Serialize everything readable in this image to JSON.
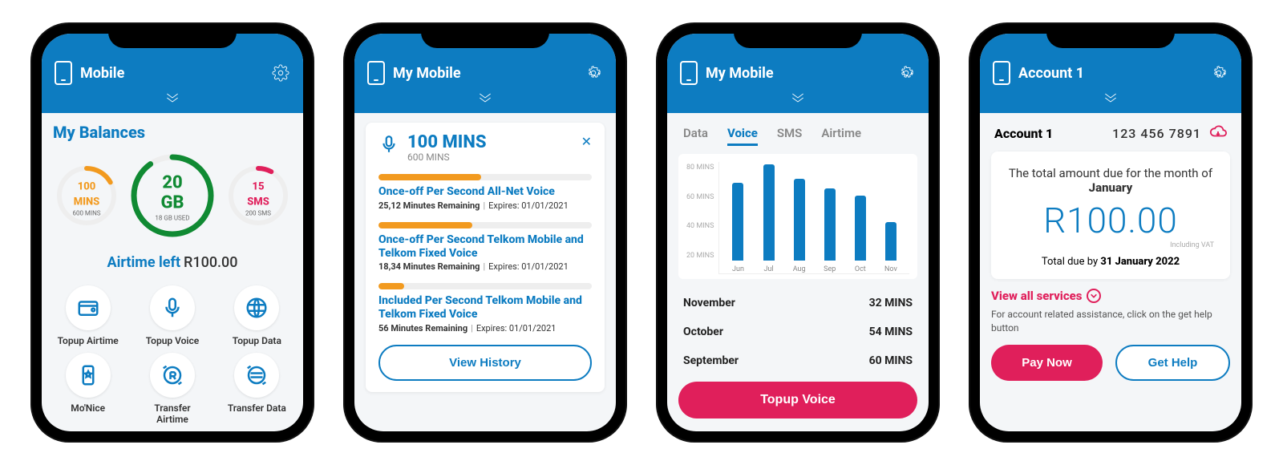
{
  "colors": {
    "brand": "#0d7cc1",
    "accent_pink": "#e01f5b",
    "accent_orange": "#f29a1f",
    "accent_green": "#108a33"
  },
  "phone1": {
    "header_title": "Mobile",
    "balances_title": "My Balances",
    "gauges": {
      "mins": {
        "value": "100 MINS",
        "sub": "600 MINS",
        "pct": 17
      },
      "data": {
        "value": "20 GB",
        "sub": "18 GB USED",
        "pct": 90
      },
      "sms": {
        "value": "15 SMS",
        "sub": "200 SMS",
        "pct": 8
      }
    },
    "airtime_label": "Airtime left",
    "airtime_value": "R100.00",
    "actions": [
      {
        "label": "Topup Airtime",
        "icon": "wallet-icon"
      },
      {
        "label": "Topup Voice",
        "icon": "mic-icon"
      },
      {
        "label": "Topup Data",
        "icon": "data-icon"
      },
      {
        "label": "Mo'Nice",
        "icon": "star-phone-icon"
      },
      {
        "label": "Transfer Airtime",
        "icon": "transfer-r-icon"
      },
      {
        "label": "Transfer Data",
        "icon": "transfer-data-icon"
      }
    ]
  },
  "phone2": {
    "header_title": "My Mobile",
    "card_title": "100 MINS",
    "card_sub": "600 MINS",
    "bundles": [
      {
        "name": "Once-off Per Second All-Net Voice",
        "remaining": "25,12 Minutes Remaining",
        "expires": "Expires: 01/01/2021",
        "pct": 48
      },
      {
        "name": "Once-off Per Second Telkom Mobile and Telkom Fixed Voice",
        "remaining": "18,34 Minutes Remaining",
        "expires": "Expires: 01/01/2021",
        "pct": 44
      },
      {
        "name": "Included Per Second Telkom Mobile and Telkom Fixed Voice",
        "remaining": "56 Minutes Remaining",
        "expires": "Expires: 01/01/2021",
        "pct": 12
      }
    ],
    "view_history_label": "View History"
  },
  "phone3": {
    "header_title": "My Mobile",
    "tabs": [
      "Data",
      "Voice",
      "SMS",
      "Airtime"
    ],
    "active_tab": "Voice",
    "usage_rows": [
      {
        "month": "November",
        "value": "32 MINS"
      },
      {
        "month": "October",
        "value": "54 MINS"
      },
      {
        "month": "September",
        "value": "60 MINS"
      }
    ],
    "topup_label": "Topup Voice"
  },
  "chart_data": {
    "type": "bar",
    "title": "",
    "xlabel": "",
    "ylabel": "MINS",
    "ylim": [
      0,
      80
    ],
    "y_ticks": [
      80,
      60,
      40,
      20
    ],
    "y_tick_suffix": "MINS",
    "categories": [
      "Jun",
      "Jul",
      "Aug",
      "Sep",
      "Oct",
      "Nov"
    ],
    "values": [
      65,
      80,
      68,
      60,
      54,
      32
    ]
  },
  "phone4": {
    "header_title": "Account 1",
    "account_name": "Account 1",
    "account_number": "123 456 7891",
    "due_line_prefix": "The total amount due for the month of ",
    "due_line_month": "January",
    "amount": "R100.00",
    "vat_note": "Including VAT",
    "due_by_prefix": "Total due by ",
    "due_by_date": "31 January 2022",
    "view_all_label": "View all services",
    "help_text": "For account related assistance, click on the get help button",
    "pay_label": "Pay Now",
    "help_label": "Get Help"
  }
}
